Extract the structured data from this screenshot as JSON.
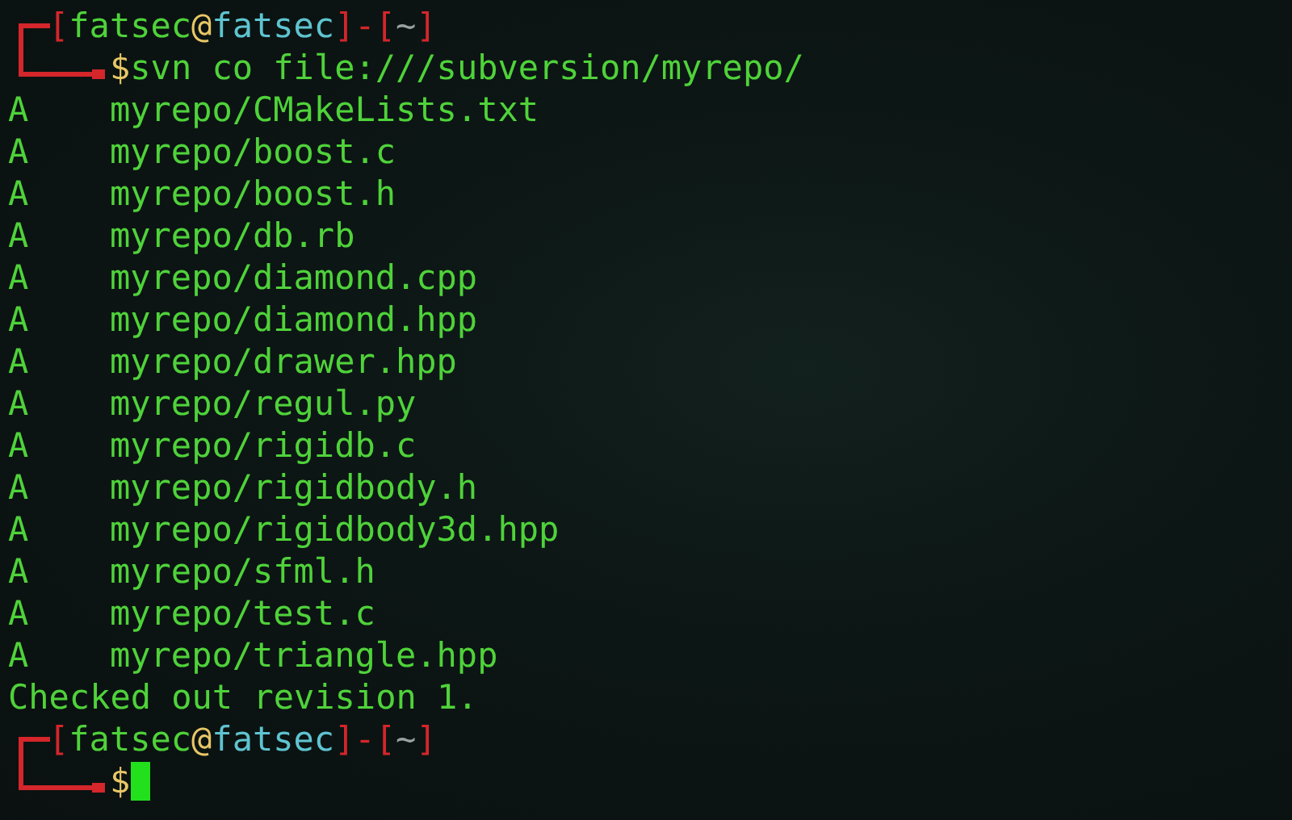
{
  "terminal": {
    "lines": [
      {
        "kind": "prompt",
        "open": "[",
        "user": "fatsec",
        "at": "@",
        "host": "fatsec",
        "between": "]-[",
        "dir": "~",
        "close": "]",
        "sign": "$",
        "command": "svn co file:///subversion/myrepo/",
        "cursor": false
      },
      {
        "kind": "output",
        "status": "A",
        "path": "myrepo/CMakeLists.txt"
      },
      {
        "kind": "output",
        "status": "A",
        "path": "myrepo/boost.c"
      },
      {
        "kind": "output",
        "status": "A",
        "path": "myrepo/boost.h"
      },
      {
        "kind": "output",
        "status": "A",
        "path": "myrepo/db.rb"
      },
      {
        "kind": "output",
        "status": "A",
        "path": "myrepo/diamond.cpp"
      },
      {
        "kind": "output",
        "status": "A",
        "path": "myrepo/diamond.hpp"
      },
      {
        "kind": "output",
        "status": "A",
        "path": "myrepo/drawer.hpp"
      },
      {
        "kind": "output",
        "status": "A",
        "path": "myrepo/regul.py"
      },
      {
        "kind": "output",
        "status": "A",
        "path": "myrepo/rigidb.c"
      },
      {
        "kind": "output",
        "status": "A",
        "path": "myrepo/rigidbody.h"
      },
      {
        "kind": "output",
        "status": "A",
        "path": "myrepo/rigidbody3d.hpp"
      },
      {
        "kind": "output",
        "status": "A",
        "path": "myrepo/sfml.h"
      },
      {
        "kind": "output",
        "status": "A",
        "path": "myrepo/test.c"
      },
      {
        "kind": "output",
        "status": "A",
        "path": "myrepo/triangle.hpp"
      },
      {
        "kind": "message",
        "text": "Checked out revision 1."
      },
      {
        "kind": "prompt",
        "open": "[",
        "user": "fatsec",
        "at": "@",
        "host": "fatsec",
        "between": "]-[",
        "dir": "~",
        "close": "]",
        "sign": "$",
        "cursor": true
      }
    ]
  }
}
